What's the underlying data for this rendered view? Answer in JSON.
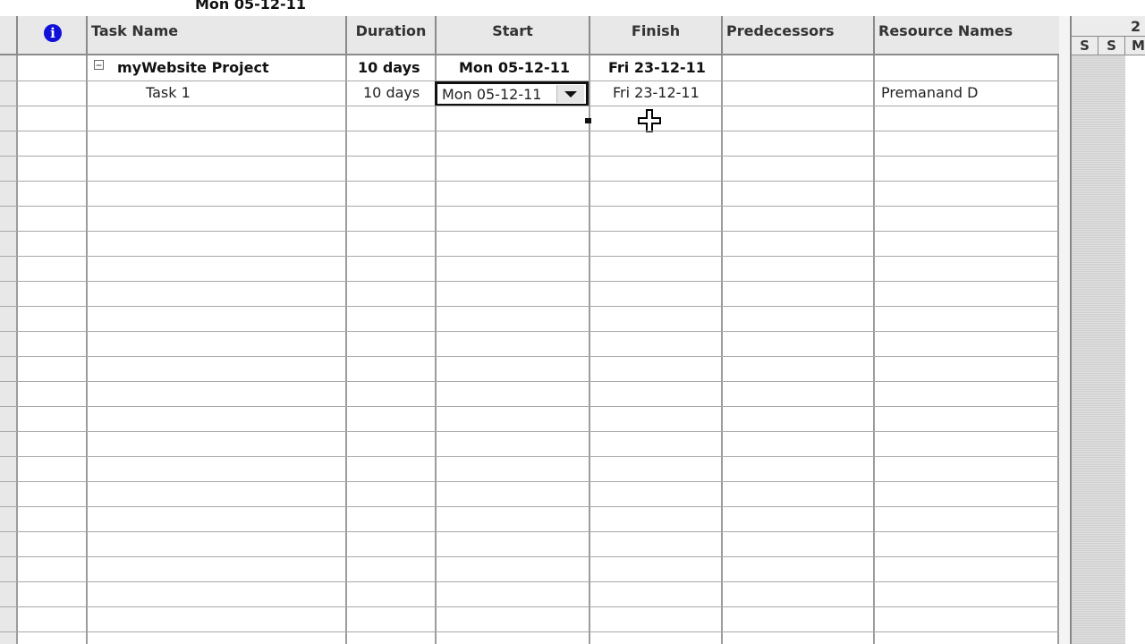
{
  "entry_bar": {
    "value": "Mon 05-12-11"
  },
  "columns": {
    "indicator_glyph": "i",
    "task_name": "Task Name",
    "duration": "Duration",
    "start": "Start",
    "finish": "Finish",
    "predecessors": "Predecessors",
    "resource_names": "Resource Names"
  },
  "rows": [
    {
      "task_name": "myWebsite Project",
      "duration": "10 days",
      "start": "Mon 05-12-11",
      "finish": "Fri 23-12-11",
      "predecessors": "",
      "resource_names": "",
      "summary": true,
      "collapse_symbol": "−"
    },
    {
      "task_name": "Task 1",
      "duration": "10 days",
      "start": "Mon 05-12-11",
      "finish": "Fri 23-12-11",
      "predecessors": "",
      "resource_names": "Premanand D",
      "summary": false
    }
  ],
  "timescale": {
    "week_label": "2",
    "days": [
      "S",
      "S",
      "M"
    ]
  },
  "icons": {
    "info": "info-icon",
    "collapse": "collapse-minus-icon",
    "dropdown": "chevron-down-icon",
    "cursor": "move-cursor-icon"
  },
  "colors": {
    "info_blue": "#1010d8",
    "header_bg": "#e8e8e8",
    "grid_line": "#9c9c9c"
  }
}
